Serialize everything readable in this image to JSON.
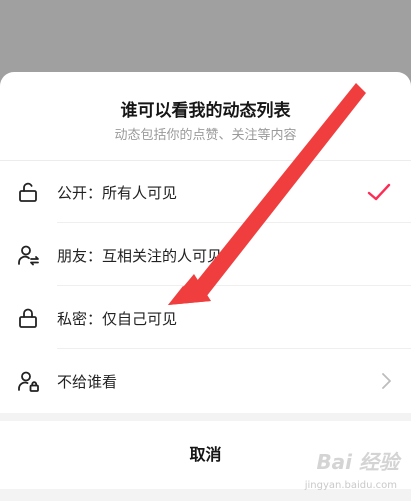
{
  "sheet": {
    "title": "谁可以看我的动态列表",
    "subtitle": "动态包括你的点赞、关注等内容"
  },
  "options": [
    {
      "id": "public",
      "label": "公开：所有人可见",
      "icon": "unlock-icon",
      "selected": true
    },
    {
      "id": "friends",
      "label": "朋友：互相关注的人可见",
      "icon": "mutual-follow-icon",
      "selected": false
    },
    {
      "id": "private",
      "label": "私密：仅自己可见",
      "icon": "lock-icon",
      "selected": false
    },
    {
      "id": "exclude",
      "label": "不给谁看",
      "icon": "user-lock-icon",
      "selected": false,
      "has_chevron": true
    }
  ],
  "cancel_label": "取消",
  "colors": {
    "accent": "#fe2c55",
    "annotation_arrow": "#f03e3e"
  },
  "watermark": {
    "logo_text": "Bai 经验",
    "url": "jingyan.baidu.com"
  }
}
